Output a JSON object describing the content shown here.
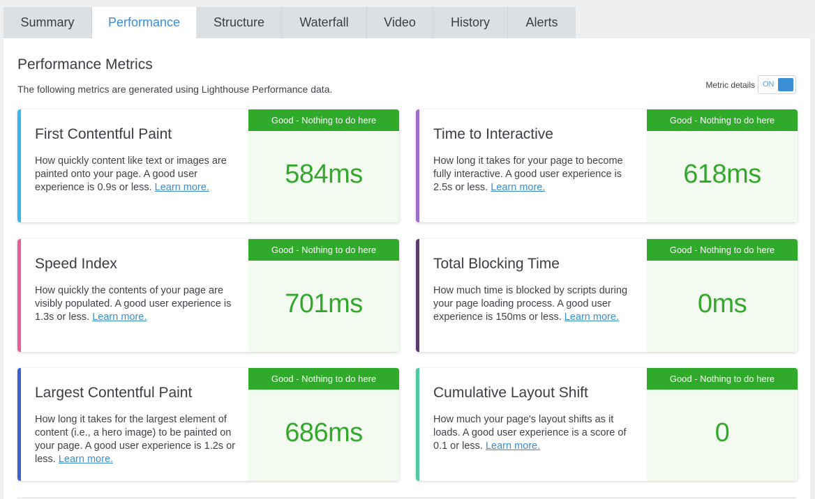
{
  "tabs": [
    {
      "label": "Summary"
    },
    {
      "label": "Performance"
    },
    {
      "label": "Structure"
    },
    {
      "label": "Waterfall"
    },
    {
      "label": "Video"
    },
    {
      "label": "History"
    },
    {
      "label": "Alerts"
    }
  ],
  "panel": {
    "title": "Performance Metrics",
    "subtitle": "The following metrics are generated using Lighthouse Performance data.",
    "toggle_label": "Metric details",
    "toggle_state": "ON"
  },
  "metrics": [
    {
      "title": "First Contentful Paint",
      "description": "How quickly content like text or images are painted onto your page. A good user experience is 0.9s or less.",
      "link": "Learn more.",
      "badge": "Good - Nothing to do here",
      "value": "584ms",
      "accent": "#35b7ef"
    },
    {
      "title": "Time to Interactive",
      "description": "How long it takes for your page to become fully interactive. A good user experience is 2.5s or less.",
      "link": "Learn more.",
      "badge": "Good - Nothing to do here",
      "value": "618ms",
      "accent": "#a06dce"
    },
    {
      "title": "Speed Index",
      "description": "How quickly the contents of your page are visibly populated. A good user experience is 1.3s or less.",
      "link": "Learn more.",
      "badge": "Good - Nothing to do here",
      "value": "701ms",
      "accent": "#ea5e9c"
    },
    {
      "title": "Total Blocking Time",
      "description": "How much time is blocked by scripts during your page loading process. A good user experience is 150ms or less.",
      "link": "Learn more.",
      "badge": "Good - Nothing to do here",
      "value": "0ms",
      "accent": "#5b3b6e"
    },
    {
      "title": "Largest Contentful Paint",
      "description": "How long it takes for the largest element of content (i.e., a hero image) to be painted on your page. A good user experience is 1.2s or less.",
      "link": "Learn more.",
      "badge": "Good - Nothing to do here",
      "value": "686ms",
      "accent": "#3a62d6"
    },
    {
      "title": "Cumulative Layout Shift",
      "description": "How much your page's layout shifts as it loads. A good user experience is a score of 0.1 or less.",
      "link": "Learn more.",
      "badge": "Good - Nothing to do here",
      "value": "0",
      "accent": "#52c9a0"
    }
  ]
}
